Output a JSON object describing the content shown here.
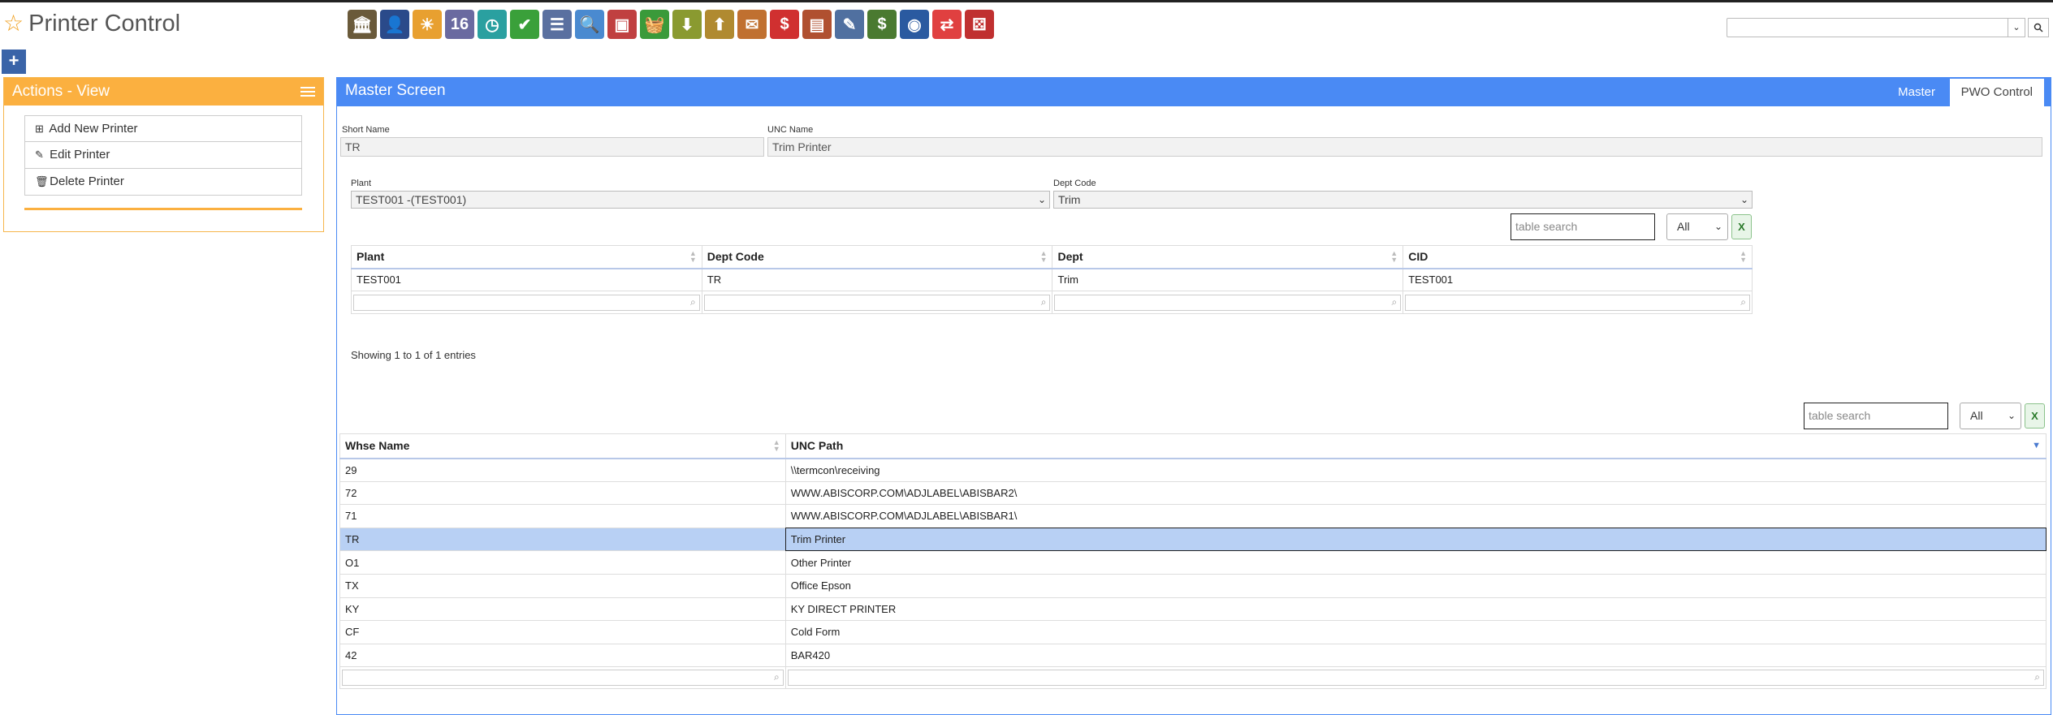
{
  "app": {
    "title": "Printer Control"
  },
  "toolbar": {
    "icons": [
      {
        "name": "bank-icon",
        "glyph": "🏛",
        "color": "#6a5a3a"
      },
      {
        "name": "user-icon",
        "glyph": "👤",
        "color": "#2a4a8a"
      },
      {
        "name": "weather-icon",
        "glyph": "☀",
        "color": "#e8a030"
      },
      {
        "name": "calendar-icon",
        "glyph": "16",
        "color": "#6a6aa0"
      },
      {
        "name": "clock-icon",
        "glyph": "◷",
        "color": "#2aa0a0"
      },
      {
        "name": "checkmark-icon",
        "glyph": "✔",
        "color": "#3aa03a"
      },
      {
        "name": "list-icon",
        "glyph": "☰",
        "color": "#5a70a0"
      },
      {
        "name": "magnifier-icon",
        "glyph": "🔍",
        "color": "#4a8ad0"
      },
      {
        "name": "monitor-icon",
        "glyph": "▣",
        "color": "#c04040"
      },
      {
        "name": "basket-icon",
        "glyph": "🧺",
        "color": "#3a9a3a"
      },
      {
        "name": "download-box-icon",
        "glyph": "⬇",
        "color": "#8a9a30"
      },
      {
        "name": "upload-box-icon",
        "glyph": "⬆",
        "color": "#b08a30"
      },
      {
        "name": "inbox-icon",
        "glyph": "✉",
        "color": "#c07030"
      },
      {
        "name": "dollar-chat-icon",
        "glyph": "$",
        "color": "#d03030"
      },
      {
        "name": "document-icon",
        "glyph": "▤",
        "color": "#b05030"
      },
      {
        "name": "pencil-icon",
        "glyph": "✎",
        "color": "#5070a0"
      },
      {
        "name": "cash-icon",
        "glyph": "$",
        "color": "#4a7a30"
      },
      {
        "name": "globe-icon",
        "glyph": "◉",
        "color": "#2a5aa0"
      },
      {
        "name": "arrows-icon",
        "glyph": "⇄",
        "color": "#e04040"
      },
      {
        "name": "dice-icon",
        "glyph": "⚄",
        "color": "#c03030"
      }
    ]
  },
  "left": {
    "title": "Actions - View",
    "actions": [
      {
        "icon": "⊞",
        "label": "Add New Printer"
      },
      {
        "icon": "✎",
        "label": "Edit Printer"
      },
      {
        "icon": "🗑",
        "label": "Delete Printer"
      }
    ]
  },
  "main": {
    "title": "Master Screen",
    "tabs": [
      "Master",
      "PWO Control"
    ],
    "form": {
      "short_name_label": "Short Name",
      "short_name_value": "TR",
      "unc_name_label": "UNC Name",
      "unc_name_value": "Trim Printer",
      "plant_label": "Plant",
      "plant_value": "TEST001 -(TEST001)",
      "dept_label": "Dept Code",
      "dept_value": "Trim"
    },
    "table1": {
      "search_placeholder": "table search",
      "page_size": "All",
      "columns": [
        "Plant",
        "Dept Code",
        "Dept",
        "CID"
      ],
      "rows": [
        [
          "TEST001",
          "TR",
          "Trim",
          "TEST001"
        ]
      ],
      "showing": "Showing 1 to 1 of 1 entries"
    },
    "table2": {
      "search_placeholder": "table search",
      "page_size": "All",
      "columns": [
        "Whse Name",
        "UNC Path"
      ],
      "rows": [
        [
          "29",
          "\\\\termcon\\receiving"
        ],
        [
          "72",
          "WWW.ABISCORP.COM\\ADJLABEL\\ABISBAR2\\"
        ],
        [
          "71",
          "WWW.ABISCORP.COM\\ADJLABEL\\ABISBAR1\\"
        ],
        [
          "TR",
          "Trim Printer"
        ],
        [
          "O1",
          "Other Printer"
        ],
        [
          "TX",
          "Office Epson"
        ],
        [
          "KY",
          "KY DIRECT PRINTER"
        ],
        [
          "CF",
          "Cold Form"
        ],
        [
          "42",
          "BAR420"
        ]
      ],
      "selected_row": 3
    }
  }
}
